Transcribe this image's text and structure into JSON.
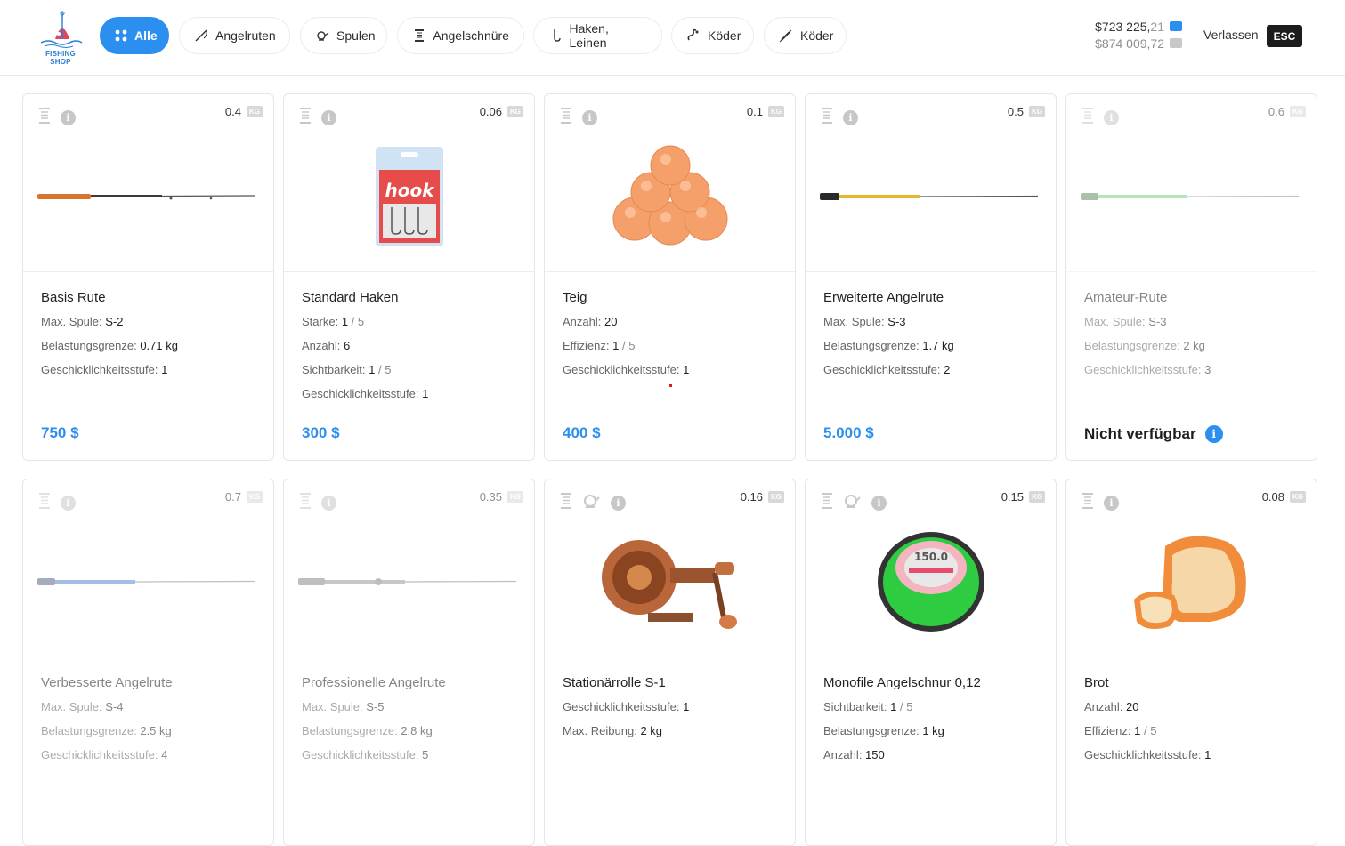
{
  "header": {
    "logo_text": "FISHING SHOP",
    "tabs": [
      {
        "label": "Alle",
        "icon": "grid-icon",
        "active": true
      },
      {
        "label": "Angelruten",
        "icon": "rod-icon"
      },
      {
        "label": "Spulen",
        "icon": "reel-icon"
      },
      {
        "label": "Angelschnüre",
        "icon": "line-spool-icon"
      },
      {
        "label": "Haken, Leinen",
        "icon": "hook-icon"
      },
      {
        "label": "Köder",
        "icon": "worm-icon"
      },
      {
        "label": "Köder",
        "icon": "lure-icon"
      }
    ],
    "balance_primary": "$723 225,",
    "balance_primary_cents": "21",
    "balance_secondary": "$874 009,",
    "balance_secondary_cents": "72",
    "exit_label": "Verlassen",
    "esc_label": "ESC"
  },
  "kg_label": "KG",
  "products": [
    {
      "name": "Basis Rute",
      "weight": "0.4",
      "image": "rod-orange",
      "stats": [
        {
          "label": "Max. Spule:",
          "value": "S-2"
        },
        {
          "label": "Belastungsgrenze:",
          "value": "0.71 kg"
        },
        {
          "label": "Geschicklichkeitsstufe:",
          "value": "1"
        }
      ],
      "price": "750 $"
    },
    {
      "name": "Standard Haken",
      "weight": "0.06",
      "image": "hook-pack",
      "stats": [
        {
          "label": "Stärke:",
          "value": "1",
          "suffix": " / 5"
        },
        {
          "label": "Anzahl:",
          "value": "6"
        },
        {
          "label": "Sichtbarkeit:",
          "value": "1",
          "suffix": " / 5"
        },
        {
          "label": "Geschicklichkeitsstufe:",
          "value": "1"
        }
      ],
      "price": "300 $"
    },
    {
      "name": "Teig",
      "weight": "0.1",
      "image": "dough-balls",
      "stats": [
        {
          "label": "Anzahl:",
          "value": "20"
        },
        {
          "label": "Effizienz:",
          "value": "1",
          "suffix": " / 5"
        },
        {
          "label": "Geschicklichkeitsstufe:",
          "value": "1"
        }
      ],
      "price": "400 $"
    },
    {
      "name": "Erweiterte Angelrute",
      "weight": "0.5",
      "image": "rod-yellow",
      "stats": [
        {
          "label": "Max. Spule:",
          "value": "S-3"
        },
        {
          "label": "Belastungsgrenze:",
          "value": "1.7 kg"
        },
        {
          "label": "Geschicklichkeitsstufe:",
          "value": "2"
        }
      ],
      "price": "5.000 $"
    },
    {
      "name": "Amateur-Rute",
      "weight": "0.6",
      "image": "rod-green",
      "stats": [
        {
          "label": "Max. Spule:",
          "value": "S-3"
        },
        {
          "label": "Belastungsgrenze:",
          "value": "2 kg"
        },
        {
          "label": "Geschicklichkeitsstufe:",
          "value": "3"
        }
      ],
      "unavailable": "Nicht verfügbar"
    },
    {
      "name": "Verbesserte Angelrute",
      "weight": "0.7",
      "image": "rod-blue",
      "stats": [
        {
          "label": "Max. Spule:",
          "value": "S-4"
        },
        {
          "label": "Belastungsgrenze:",
          "value": "2.5 kg"
        },
        {
          "label": "Geschicklichkeitsstufe:",
          "value": "4"
        }
      ]
    },
    {
      "name": "Professionelle Angelrute",
      "weight": "0.35",
      "image": "rod-silver",
      "stats": [
        {
          "label": "Max. Spule:",
          "value": "S-5"
        },
        {
          "label": "Belastungsgrenze:",
          "value": "2.8 kg"
        },
        {
          "label": "Geschicklichkeitsstufe:",
          "value": "5"
        }
      ]
    },
    {
      "name": "Stationärrolle S-1",
      "weight": "0.16",
      "image": "reel",
      "reel_icon": true,
      "stats": [
        {
          "label": "Geschicklichkeitsstufe:",
          "value": "1"
        },
        {
          "label": "Max. Reibung:",
          "value": "2 kg"
        }
      ]
    },
    {
      "name": "Monofile Angelschnur 0,12",
      "weight": "0.15",
      "image": "line-spool",
      "reel_icon": true,
      "spool_label": "150.0",
      "stats": [
        {
          "label": "Sichtbarkeit:",
          "value": "1",
          "suffix": " / 5"
        },
        {
          "label": "Belastungsgrenze:",
          "value": "1 kg"
        },
        {
          "label": "Anzahl:",
          "value": "150"
        }
      ]
    },
    {
      "name": "Brot",
      "weight": "0.08",
      "image": "bread",
      "stats": [
        {
          "label": "Anzahl:",
          "value": "20"
        },
        {
          "label": "Effizienz:",
          "value": "1",
          "suffix": " / 5"
        },
        {
          "label": "Geschicklichkeitsstufe:",
          "value": "1"
        }
      ]
    }
  ]
}
